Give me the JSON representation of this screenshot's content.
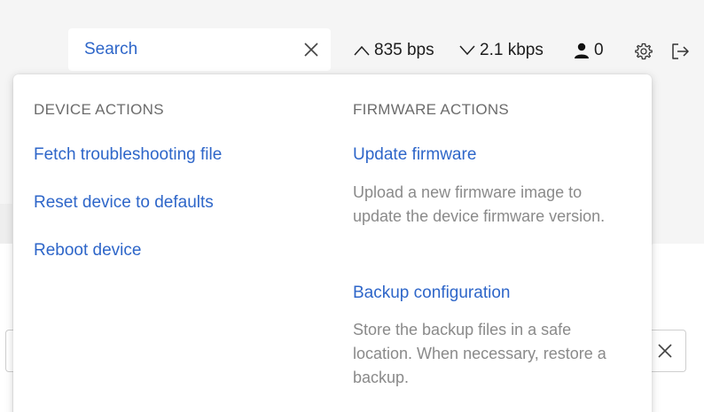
{
  "topbar": {
    "search_label": "Search",
    "upload_rate": "835 bps",
    "download_rate": "2.1 kbps",
    "user_count": "0"
  },
  "menu": {
    "device_heading": "DEVICE ACTIONS",
    "device_items": [
      {
        "label": "Fetch troubleshooting file"
      },
      {
        "label": "Reset device to defaults"
      },
      {
        "label": "Reboot device"
      }
    ],
    "firmware_heading": "FIRMWARE ACTIONS",
    "firmware_items": [
      {
        "label": "Update firmware",
        "description": "Upload a new firmware image to update the device firmware version."
      },
      {
        "label": "Backup configuration",
        "description": "Store the backup files in a safe location. When necessary, restore a backup."
      }
    ]
  },
  "colors": {
    "link": "#2e66c9",
    "heading": "#6c6c6c",
    "description": "#8a8a8a",
    "page_bg": "#f5f5f5"
  }
}
